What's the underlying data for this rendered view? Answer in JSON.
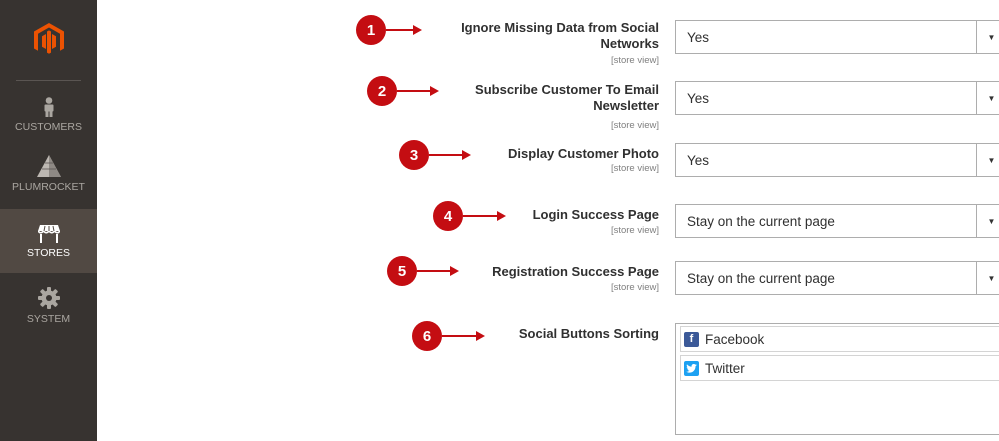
{
  "sidebar": {
    "logo_icon": "magento-logo",
    "items": [
      {
        "label": "CUSTOMERS",
        "icon": "person-icon",
        "active": false
      },
      {
        "label": "PLUMROCKET",
        "icon": "plumrocket-pyramid-icon",
        "active": false
      },
      {
        "label": "STORES",
        "icon": "store-icon",
        "active": true
      },
      {
        "label": "SYSTEM",
        "icon": "gear-icon",
        "active": false
      }
    ]
  },
  "colors": {
    "sidebar_bg": "#373330",
    "sidebar_active_bg": "#514943",
    "logo_orange": "#eb5202",
    "callout_red": "#c40d12",
    "facebook_blue": "#3b5998",
    "twitter_blue": "#1da1f2"
  },
  "form": {
    "rows": [
      {
        "label_line1": "Ignore Missing Data from Social",
        "label_line2": "Networks",
        "scope": "[store view]",
        "value": "Yes"
      },
      {
        "label_line1": "Subscribe Customer To Email",
        "label_line2": "Newsletter",
        "scope": "[store view]",
        "value": "Yes"
      },
      {
        "label_line1": "Display Customer Photo",
        "scope": "[store view]",
        "value": "Yes"
      },
      {
        "label_line1": "Login Success Page",
        "scope": "[store view]",
        "value": "Stay on the current page"
      },
      {
        "label_line1": "Registration Success Page",
        "scope": "[store view]",
        "value": "Stay on the current page"
      }
    ],
    "sorting": {
      "label": "Social Buttons Sorting",
      "items": [
        {
          "label": "Facebook",
          "icon": "facebook-icon"
        },
        {
          "label": "Twitter",
          "icon": "twitter-icon"
        }
      ]
    }
  },
  "callouts": [
    "1",
    "2",
    "3",
    "4",
    "5",
    "6"
  ],
  "select_arrow_glyph": "▼",
  "facebook_glyph": "f",
  "twitter_glyph": "🐦"
}
